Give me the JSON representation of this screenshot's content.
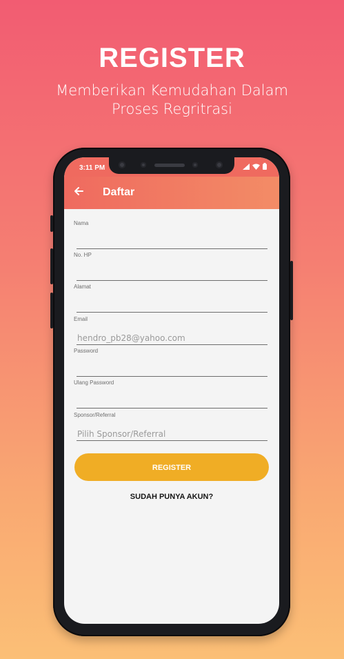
{
  "hero": {
    "title": "REGISTER",
    "subtitle_line1": "Memberikan Kemudahan Dalam",
    "subtitle_line2": "Proses Regritrasi"
  },
  "status_bar": {
    "time": "3:11 PM",
    "icons": [
      "signal-icon",
      "wifi-icon",
      "battery-icon"
    ]
  },
  "app_bar": {
    "back_icon": "arrow-left-icon",
    "title": "Daftar"
  },
  "form": {
    "fields": [
      {
        "label": "Nama",
        "value": "",
        "placeholder": ""
      },
      {
        "label": "No. HP",
        "value": "",
        "placeholder": ""
      },
      {
        "label": "Alamat",
        "value": "",
        "placeholder": ""
      },
      {
        "label": "Email",
        "value": "",
        "placeholder": "hendro_pb28@yahoo.com"
      },
      {
        "label": "Password",
        "value": "",
        "placeholder": ""
      },
      {
        "label": "Ulang Password",
        "value": "",
        "placeholder": ""
      },
      {
        "label": "Sponsor/Referral",
        "value": "",
        "placeholder": "Pilih Sponsor/Referral"
      }
    ],
    "register_label": "REGISTER",
    "login_link": "SUDAH PUNYA AKUN?"
  },
  "colors": {
    "accent": "#f0ad25",
    "appbar": "#ef6a5f",
    "gradient_top": "#f25c72",
    "gradient_bottom": "#fbbf76"
  }
}
